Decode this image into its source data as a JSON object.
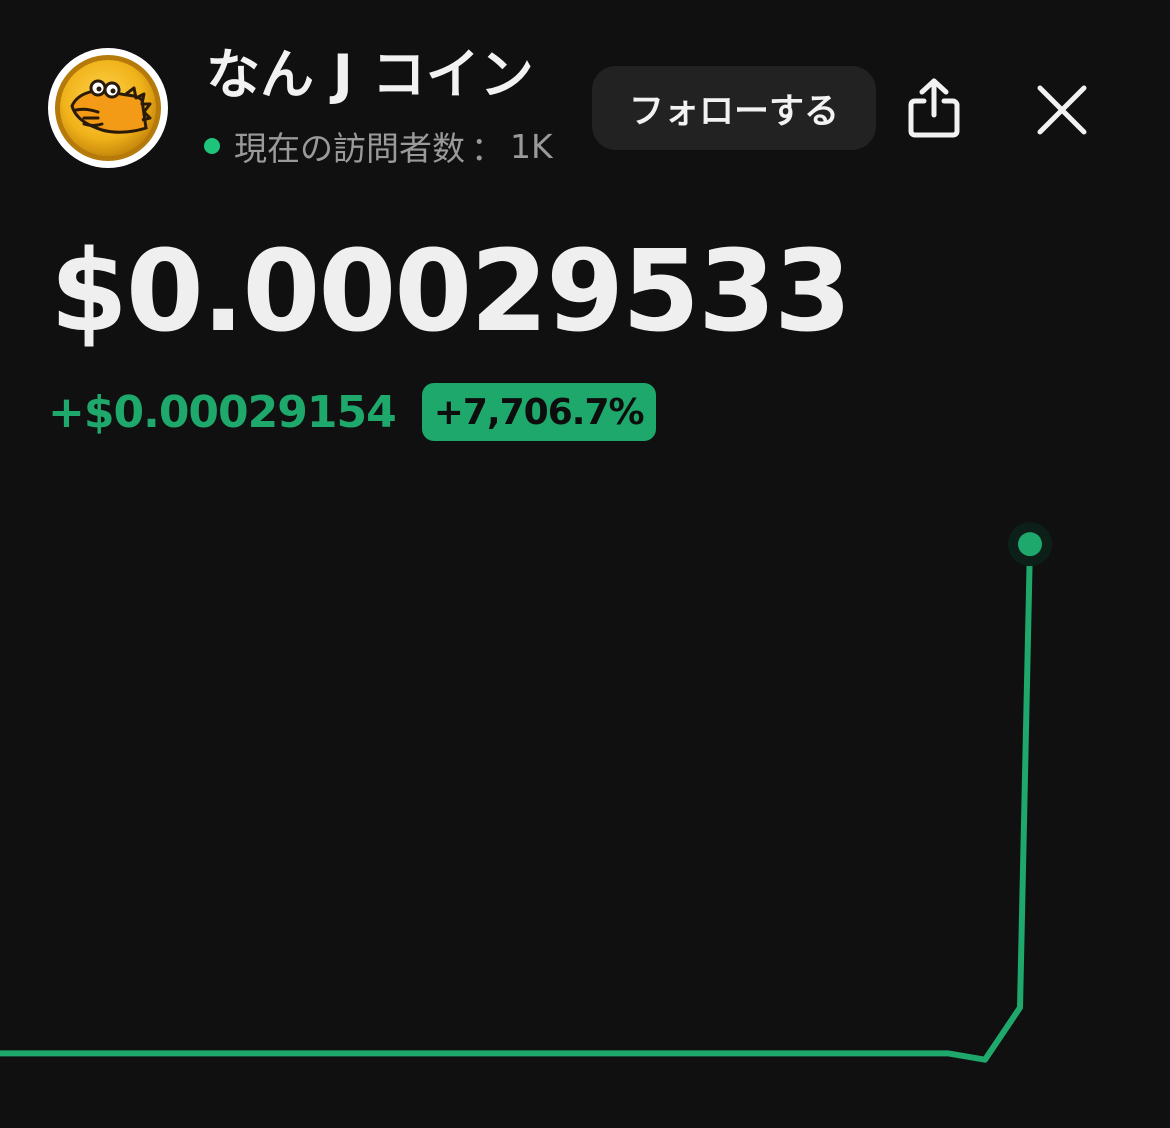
{
  "header": {
    "coin_name": "なん J コイン",
    "visitors_label": "現在の訪問者数",
    "visitors_separator": "：",
    "visitors_count": "1K",
    "follow_label": "フォローする",
    "share_icon": "share-icon",
    "close_icon": "close-icon"
  },
  "price": {
    "current": "$0.00029533",
    "change_abs": "+$0.00029154",
    "change_pct": "+7,706.7%"
  },
  "colors": {
    "background": "#101010",
    "accent_green": "#1fa86b",
    "live_dot": "#1fc47c",
    "coin_gold": "#f0b21a"
  },
  "chart_data": {
    "type": "line",
    "series": [
      {
        "values": [
          3.79e-06,
          3.79e-06,
          3.79e-06,
          3.79e-06,
          3.79e-06,
          3.79e-06,
          3.79e-06,
          3.79e-06,
          3.79e-06,
          3.79e-06,
          3.79e-06,
          3.79e-06,
          3.79e-06,
          3.79e-06,
          3.79e-06,
          3.79e-06,
          3.79e-06,
          3.79e-06,
          3.79e-06,
          3.79e-06,
          3.79e-06,
          3.79e-06,
          3.79e-06,
          3.79e-06,
          3.79e-06,
          3.79e-06,
          3.79e-06,
          2e-07,
          3e-05,
          0.00029533
        ]
      }
    ],
    "ylim": [
      0,
      0.0003
    ],
    "grid": false,
    "end_marker": true
  }
}
